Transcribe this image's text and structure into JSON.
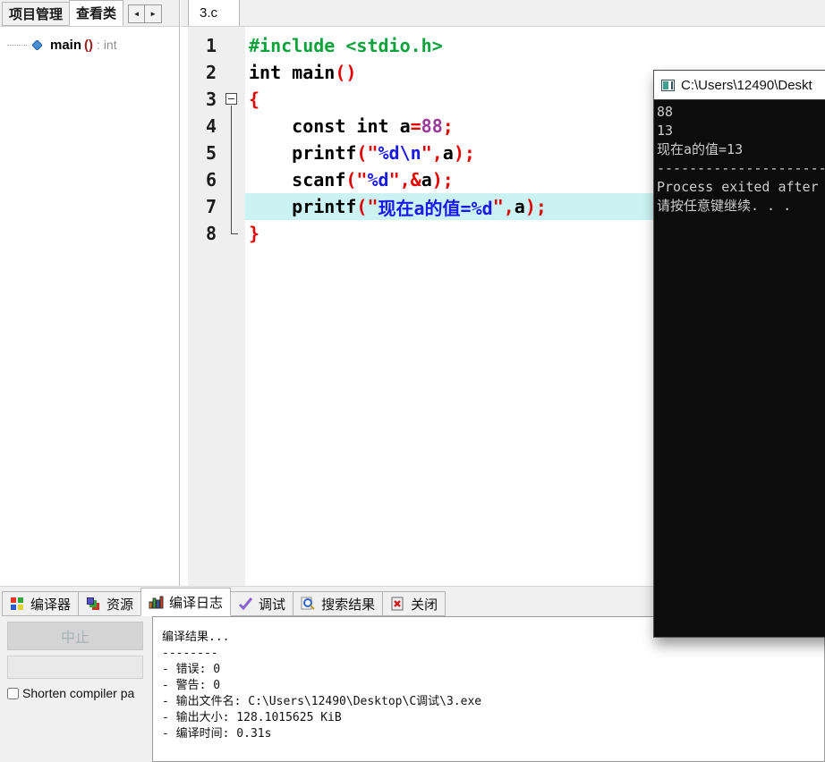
{
  "colors": {
    "code_green": "#0da33c",
    "code_red": "#e40000",
    "code_purple": "#993a9b",
    "code_blue": "#1a1ae6",
    "line_highlight": "#cbf3f3",
    "console_bg": "#0c0c0c",
    "console_fg": "#cccccc"
  },
  "sidebar": {
    "tabs": [
      {
        "label": "项目管理",
        "active": false
      },
      {
        "label": "查看类",
        "active": true
      }
    ],
    "scroll_left": "◄",
    "scroll_right": "►",
    "tree_item": {
      "name": "main",
      "parens": "()",
      "suffix": ": int"
    }
  },
  "editor": {
    "file_tab": "3.c",
    "lines": [
      {
        "num": "1",
        "fold": "none",
        "highlight": false,
        "segments": [
          [
            "g",
            "#include <stdio.h>"
          ]
        ]
      },
      {
        "num": "2",
        "fold": "none",
        "highlight": false,
        "segments": [
          [
            "k",
            "int main"
          ],
          [
            "r",
            "()"
          ]
        ]
      },
      {
        "num": "3",
        "fold": "open",
        "highlight": false,
        "segments": [
          [
            "r",
            "{"
          ]
        ]
      },
      {
        "num": "4",
        "fold": "line",
        "highlight": false,
        "segments": [
          [
            "k",
            "    const int a"
          ],
          [
            "r",
            "="
          ],
          [
            "p",
            "88"
          ],
          [
            "r",
            ";"
          ]
        ]
      },
      {
        "num": "5",
        "fold": "line",
        "highlight": false,
        "segments": [
          [
            "k",
            "    printf"
          ],
          [
            "r",
            "(\""
          ],
          [
            "b",
            "%d\\n"
          ],
          [
            "r",
            "\","
          ],
          [
            "k",
            "a"
          ],
          [
            "r",
            ");"
          ]
        ]
      },
      {
        "num": "6",
        "fold": "line",
        "highlight": false,
        "segments": [
          [
            "k",
            "    scanf"
          ],
          [
            "r",
            "(\""
          ],
          [
            "b",
            "%d"
          ],
          [
            "r",
            "\",&"
          ],
          [
            "k",
            "a"
          ],
          [
            "r",
            ");"
          ]
        ]
      },
      {
        "num": "7",
        "fold": "line",
        "highlight": true,
        "segments": [
          [
            "k",
            "    printf"
          ],
          [
            "r",
            "(\""
          ],
          [
            "b",
            "现在a的值=%d"
          ],
          [
            "r",
            "\","
          ],
          [
            "k",
            "a"
          ],
          [
            "r",
            ");"
          ]
        ]
      },
      {
        "num": "8",
        "fold": "end",
        "highlight": false,
        "segments": [
          [
            "r",
            "}"
          ]
        ]
      }
    ]
  },
  "console": {
    "title": "C:\\Users\\12490\\Deskt",
    "lines": [
      "88",
      "13",
      "现在a的值=13",
      "----------------------------------------",
      "Process exited after",
      "请按任意键继续. . ."
    ]
  },
  "bottom": {
    "tabs": [
      {
        "id": "compiler",
        "label": "编译器",
        "icon": "grid-icon",
        "active": false
      },
      {
        "id": "resources",
        "label": "资源",
        "icon": "layers-icon",
        "active": false
      },
      {
        "id": "compile-log",
        "label": "编译日志",
        "icon": "bar-chart-icon",
        "active": true
      },
      {
        "id": "debug",
        "label": "调试",
        "icon": "checkmark-icon",
        "active": false
      },
      {
        "id": "search-results",
        "label": "搜索结果",
        "icon": "search-icon",
        "active": false
      },
      {
        "id": "close",
        "label": "关闭",
        "icon": "close-icon",
        "active": false
      }
    ],
    "abort_button": "中止",
    "checkbox_label": "Shorten compiler pa",
    "log_lines": [
      "编译结果...",
      "--------",
      "- 错误: 0",
      "- 警告: 0",
      "- 输出文件名: C:\\Users\\12490\\Desktop\\C调试\\3.exe",
      "- 输出大小: 128.1015625 KiB",
      "- 编译时间: 0.31s"
    ]
  }
}
